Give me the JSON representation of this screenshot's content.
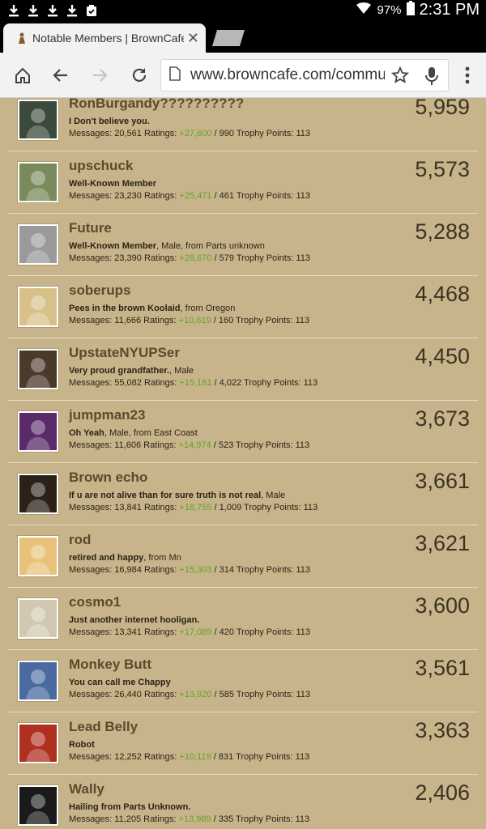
{
  "status_bar": {
    "notifications": [
      "download-icon",
      "download-icon",
      "download-icon",
      "download-icon",
      "clipboard-icon"
    ],
    "battery_pct": "97%",
    "time": "2:31 PM"
  },
  "tabs": [
    {
      "title": "Notable Members | BrownCafe"
    }
  ],
  "address_bar": {
    "url": "www.browncafe.com/commu"
  },
  "colors": {
    "page_bg": "#c8b48a",
    "positive_rating": "#5fa52a",
    "name": "#5a4a2e"
  },
  "members": [
    {
      "name": "RonBurgandy??????????",
      "title": "I Don't believe you.",
      "title_extra": "",
      "messages": "20,561",
      "ratings_pos": "+27,600",
      "ratings_neg": "990",
      "trophy": "113",
      "score": "5,959"
    },
    {
      "name": "upschuck",
      "title": "Well-Known Member",
      "title_extra": "",
      "messages": "23,230",
      "ratings_pos": "+25,471",
      "ratings_neg": "461",
      "trophy": "113",
      "score": "5,573"
    },
    {
      "name": "Future",
      "title": "Well-Known Member",
      "title_extra": ", Male, from Parts unknown",
      "messages": "23,390",
      "ratings_pos": "+28,670",
      "ratings_neg": "579",
      "trophy": "113",
      "score": "5,288"
    },
    {
      "name": "soberups",
      "title": "Pees in the brown Koolaid",
      "title_extra": ", from Oregon",
      "messages": "11,666",
      "ratings_pos": "+10,619",
      "ratings_neg": "160",
      "trophy": "113",
      "score": "4,468"
    },
    {
      "name": "UpstateNYUPSer",
      "title": "Very proud grandfather.",
      "title_extra": ", Male",
      "messages": "55,082",
      "ratings_pos": "+15,181",
      "ratings_neg": "4,022",
      "trophy": "113",
      "score": "4,450"
    },
    {
      "name": "jumpman23",
      "title": "Oh Yeah",
      "title_extra": ", Male, from East Coast",
      "messages": "11,606",
      "ratings_pos": "+14,974",
      "ratings_neg": "523",
      "trophy": "113",
      "score": "3,673"
    },
    {
      "name": "Brown echo",
      "title": "If u are not alive than for sure truth is not real",
      "title_extra": ", Male",
      "messages": "13,841",
      "ratings_pos": "+18,755",
      "ratings_neg": "1,009",
      "trophy": "113",
      "score": "3,661"
    },
    {
      "name": "rod",
      "title": "retired and happy",
      "title_extra": ", from Mn",
      "messages": "16,984",
      "ratings_pos": "+15,303",
      "ratings_neg": "314",
      "trophy": "113",
      "score": "3,621"
    },
    {
      "name": "cosmo1",
      "title": "Just another internet hooligan.",
      "title_extra": "",
      "messages": "13,341",
      "ratings_pos": "+17,089",
      "ratings_neg": "420",
      "trophy": "113",
      "score": "3,600"
    },
    {
      "name": "Monkey Butt",
      "title": "You can call me Chappy",
      "title_extra": "",
      "messages": "26,440",
      "ratings_pos": "+13,920",
      "ratings_neg": "585",
      "trophy": "113",
      "score": "3,561"
    },
    {
      "name": "Lead Belly",
      "title": "Robot",
      "title_extra": "",
      "messages": "12,252",
      "ratings_pos": "+10,119",
      "ratings_neg": "831",
      "trophy": "113",
      "score": "3,363"
    },
    {
      "name": "Wally",
      "title": "Hailing from Parts Unknown.",
      "title_extra": "",
      "messages": "11,205",
      "ratings_pos": "+13,989",
      "ratings_neg": "335",
      "trophy": "113",
      "score": "2,406"
    }
  ],
  "labels": {
    "messages": "Messages:",
    "ratings": "Ratings:",
    "trophy": "Trophy Points:"
  }
}
